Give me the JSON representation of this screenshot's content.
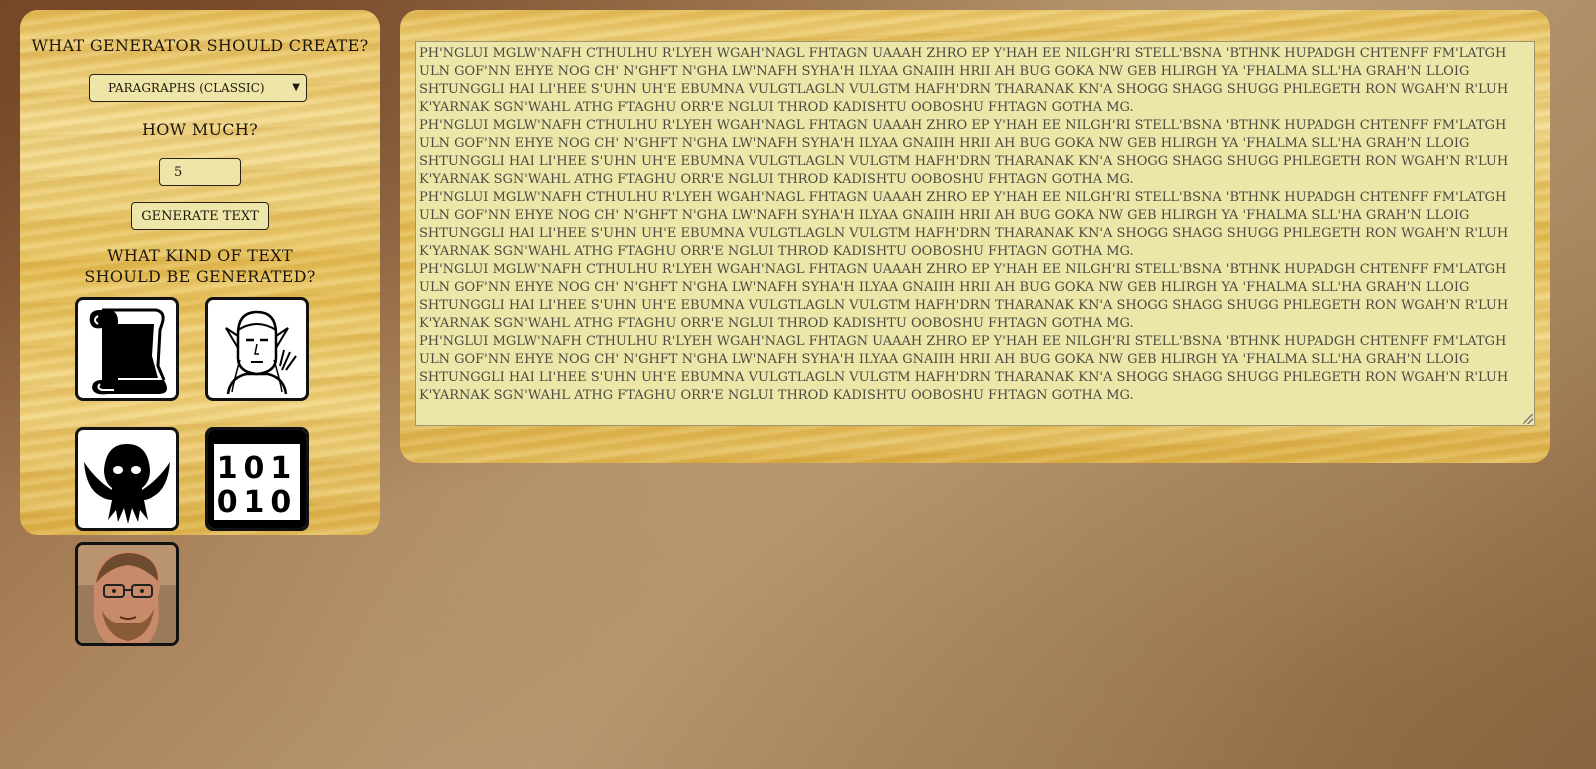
{
  "controls": {
    "generator_heading": "What generator should create?",
    "generator_selected": "Paragraphs (classic)",
    "amount_heading": "How much?",
    "amount_value": "5",
    "generate_button": "Generate text",
    "kind_heading_line1": "What kind of text",
    "kind_heading_line2": "should be generated?"
  },
  "text_kinds": [
    {
      "icon": "scroll-icon"
    },
    {
      "icon": "elf-icon"
    },
    {
      "icon": "cthulhu-icon"
    },
    {
      "icon": "binary-icon"
    },
    {
      "icon": "person-photo-icon"
    }
  ],
  "binary_icon": {
    "row1": "101",
    "row2": "010"
  },
  "output": {
    "paragraphs": [
      "Ph'nglui mglw'nafh Cthulhu R'lyeh wgah'nagl fhtagn uaaah zhro ep y'hah ee nilgh'ri stell'bsna 'bthnk hupadgh chtenff fm'latgh uln gof'nn ehye nog ch' n'ghft n'gha lw'nafh syha'h ilyaa gnaiih hrii ah bug goka nw geb hlirgh ya 'fhalma sll'ha grah'n lloig shtunggli hai li'hee s'uhn uh'e ebumna vulgtlagln vulgtm hafh'drn tharanak kn'a shogg shagg shugg phlegeth ron wgah'n r'luh k'yarnak sgn'wahl athg ftaghu orr'e nglui throd kadishtu ooboshu fhtagn gotha mg.",
      "Ph'nglui mglw'nafh Cthulhu R'lyeh wgah'nagl fhtagn uaaah zhro ep y'hah ee nilgh'ri stell'bsna 'bthnk hupadgh chtenff fm'latgh uln gof'nn ehye nog ch' n'ghft n'gha lw'nafh syha'h ilyaa gnaiih hrii ah bug goka nw geb hlirgh ya 'fhalma sll'ha grah'n lloig shtunggli hai li'hee s'uhn uh'e ebumna vulgtlagln vulgtm hafh'drn tharanak kn'a shogg shagg shugg phlegeth ron wgah'n r'luh k'yarnak sgn'wahl athg ftaghu orr'e nglui throd kadishtu ooboshu fhtagn gotha mg.",
      "Ph'nglui mglw'nafh Cthulhu R'lyeh wgah'nagl fhtagn uaaah zhro ep y'hah ee nilgh'ri stell'bsna 'bthnk hupadgh chtenff fm'latgh uln gof'nn ehye nog ch' n'ghft n'gha lw'nafh syha'h ilyaa gnaiih hrii ah bug goka nw geb hlirgh ya 'fhalma sll'ha grah'n lloig shtunggli hai li'hee s'uhn uh'e ebumna vulgtlagln vulgtm hafh'drn tharanak kn'a shogg shagg shugg phlegeth ron wgah'n r'luh k'yarnak sgn'wahl athg ftaghu orr'e nglui throd kadishtu ooboshu fhtagn gotha mg.",
      "Ph'nglui mglw'nafh Cthulhu R'lyeh wgah'nagl fhtagn uaaah zhro ep y'hah ee nilgh'ri stell'bsna 'bthnk hupadgh chtenff fm'latgh uln gof'nn ehye nog ch' n'ghft n'gha lw'nafh syha'h ilyaa gnaiih hrii ah bug goka nw geb hlirgh ya 'fhalma sll'ha grah'n lloig shtunggli hai li'hee s'uhn uh'e ebumna vulgtlagln vulgtm hafh'drn tharanak kn'a shogg shagg shugg phlegeth ron wgah'n r'luh k'yarnak sgn'wahl athg ftaghu orr'e nglui throd kadishtu ooboshu fhtagn gotha mg.",
      "Ph'nglui mglw'nafh Cthulhu R'lyeh wgah'nagl fhtagn uaaah zhro ep y'hah ee nilgh'ri stell'bsna 'bthnk hupadgh chtenff fm'latgh uln gof'nn ehye nog ch' n'ghft n'gha lw'nafh syha'h ilyaa gnaiih hrii ah bug goka nw geb hlirgh ya 'fhalma sll'ha grah'n lloig shtunggli hai li'hee s'uhn uh'e ebumna vulgtlagln vulgtm hafh'drn tharanak kn'a shogg shagg shugg phlegeth ron wgah'n r'luh k'yarnak sgn'wahl athg ftaghu orr'e nglui throd kadishtu ooboshu fhtagn gotha mg."
    ]
  }
}
